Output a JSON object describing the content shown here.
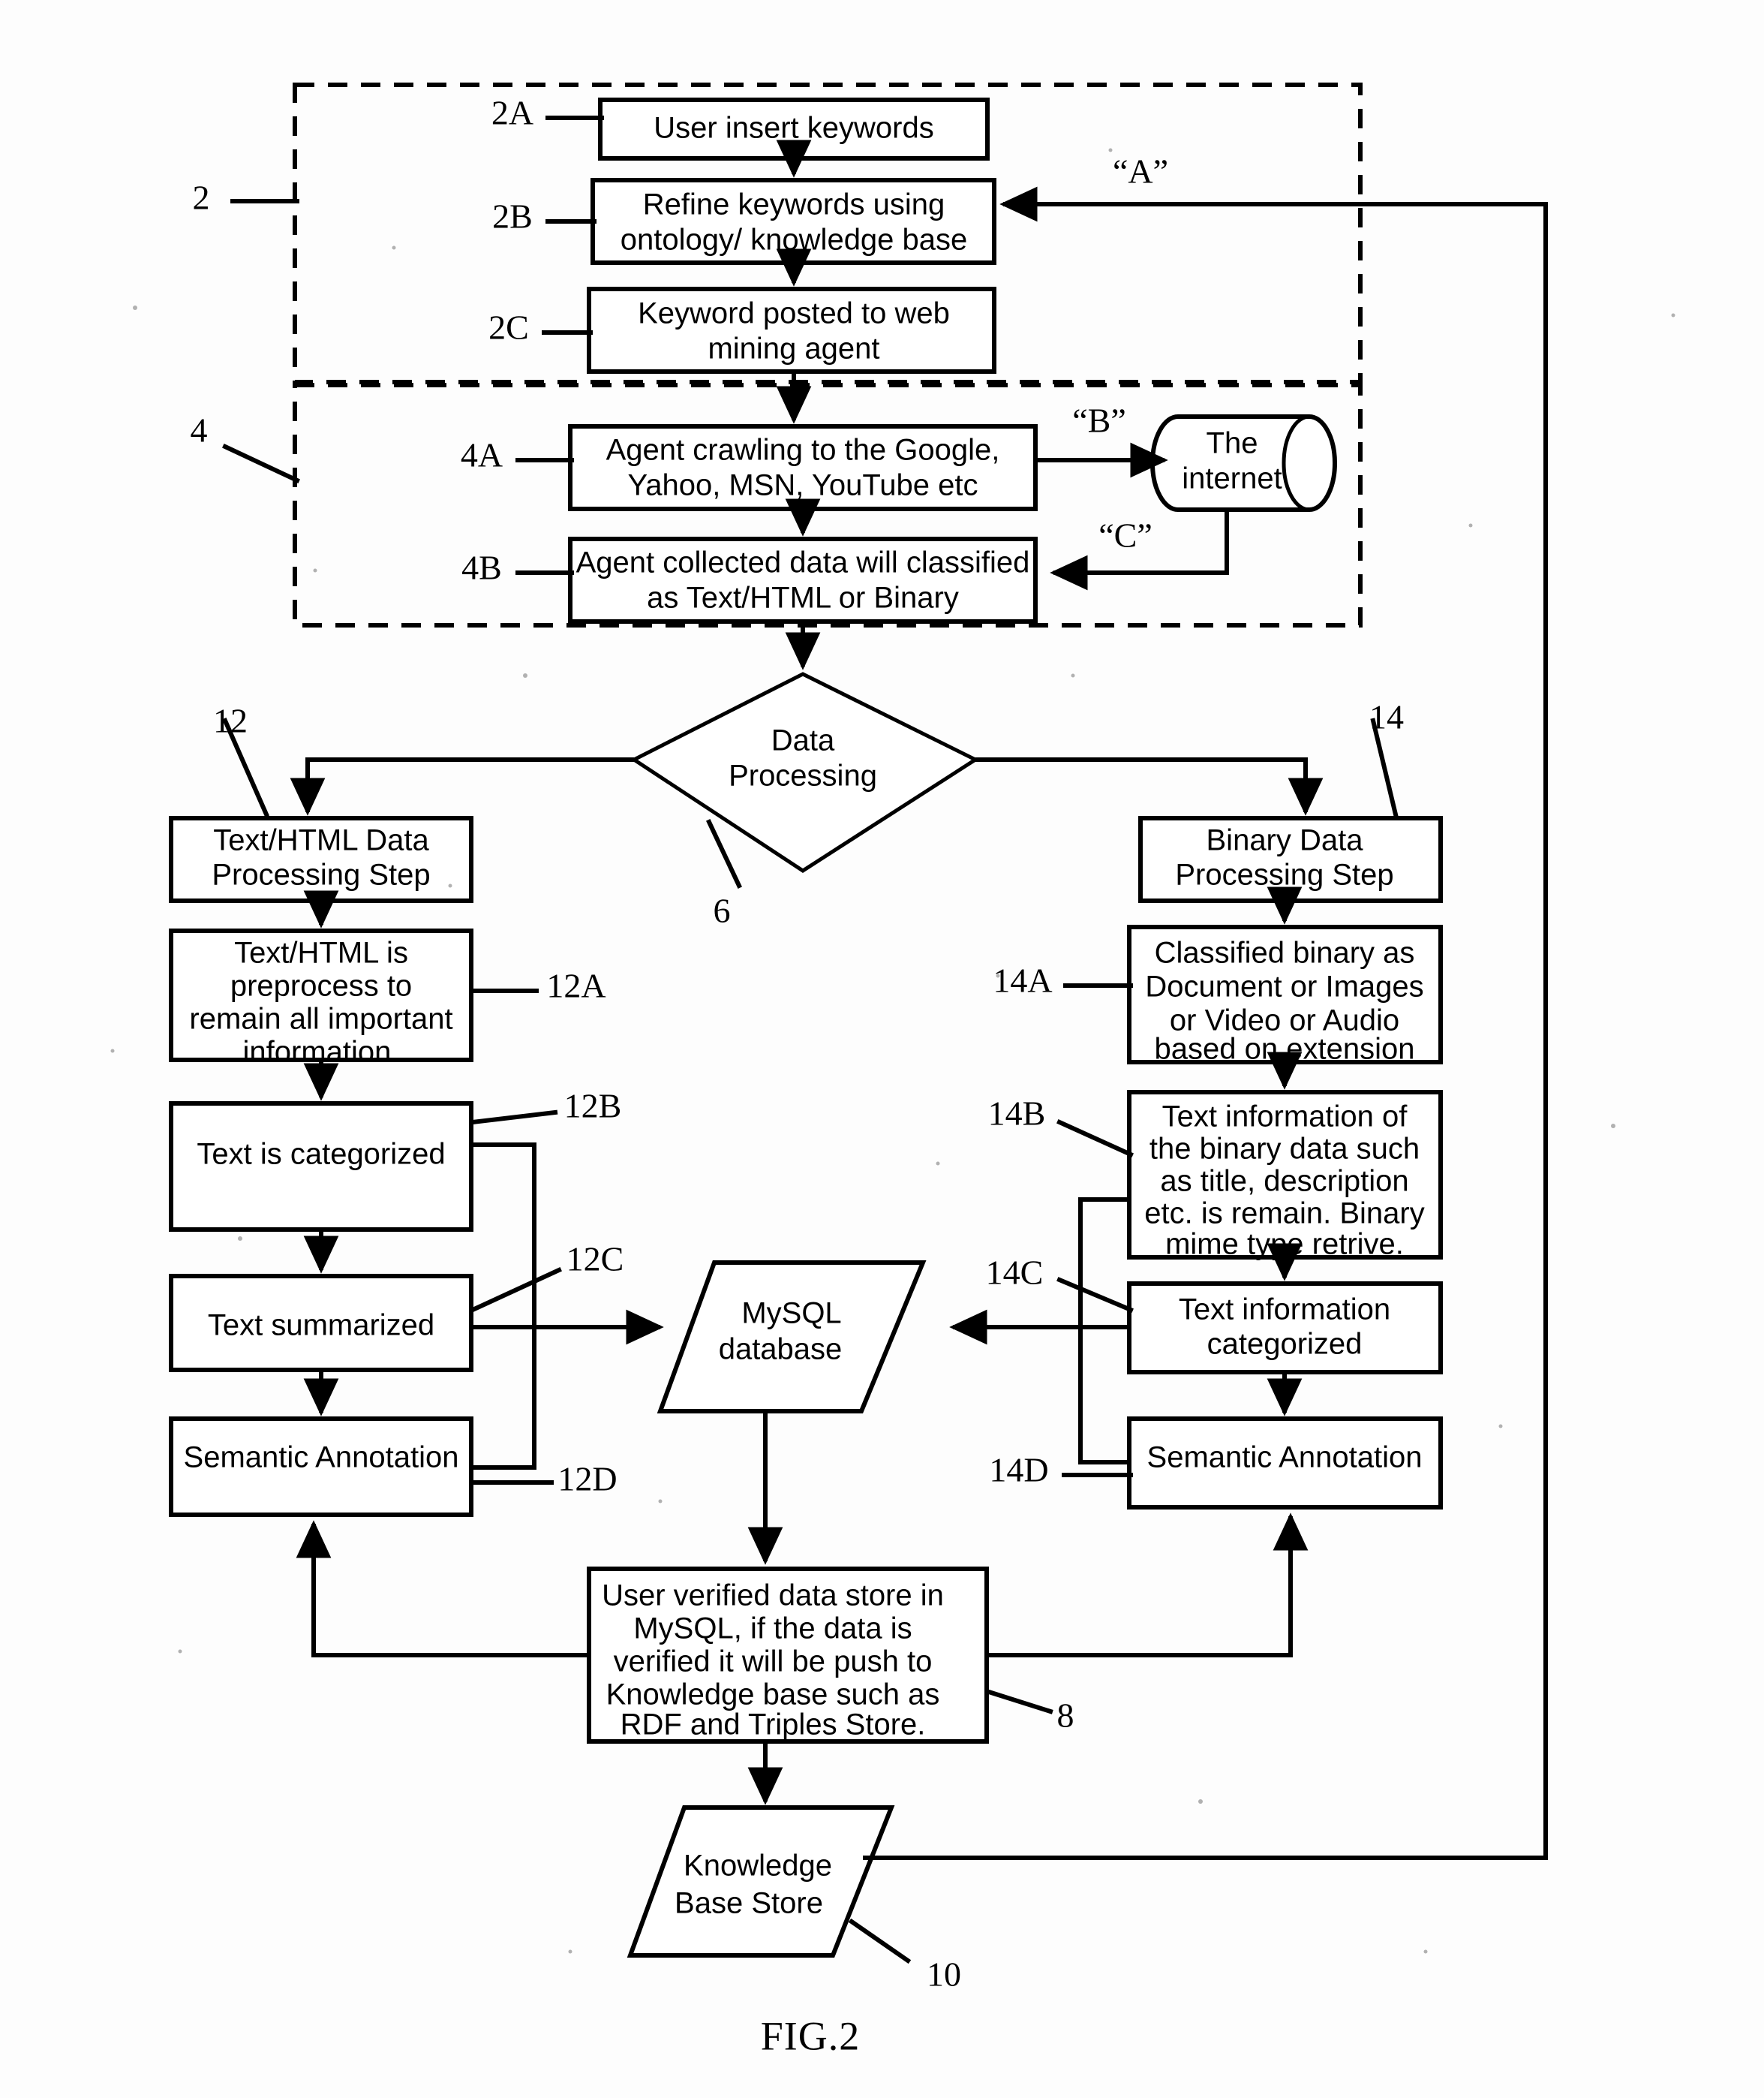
{
  "figure": {
    "label": "FIG.2",
    "title_none": ""
  },
  "groups": [
    {
      "id": "g2",
      "ref": "2"
    },
    {
      "id": "g4",
      "ref": "4"
    }
  ],
  "connectors": [
    {
      "id": "A",
      "label": "“A”"
    },
    {
      "id": "B",
      "label": "“B”"
    },
    {
      "id": "C",
      "label": "“C”"
    }
  ],
  "nodes": {
    "n2A": {
      "ref": "2A",
      "shape": "process",
      "lines": [
        "User insert keywords"
      ]
    },
    "n2B": {
      "ref": "2B",
      "shape": "process",
      "lines": [
        "Refine keywords using",
        "ontology/ knowledge base"
      ]
    },
    "n2C": {
      "ref": "2C",
      "shape": "process",
      "lines": [
        "Keyword posted to web",
        "mining agent"
      ]
    },
    "n4A": {
      "ref": "4A",
      "shape": "process",
      "lines": [
        "Agent crawling to the Google,",
        "Yahoo, MSN, YouTube etc"
      ]
    },
    "n4B": {
      "ref": "4B",
      "shape": "process",
      "lines": [
        "Agent collected data will classified",
        "as Text/HTML or Binary"
      ]
    },
    "nInternet": {
      "ref": "",
      "shape": "cylinder",
      "lines": [
        "The",
        "internet"
      ]
    },
    "n6": {
      "ref": "6",
      "shape": "decision",
      "lines": [
        "Data",
        "Processing"
      ]
    },
    "n12": {
      "ref": "12",
      "shape": "process",
      "lines": [
        "Text/HTML Data",
        "Processing Step"
      ]
    },
    "n12A": {
      "ref": "12A",
      "shape": "process",
      "lines": [
        "Text/HTML is",
        "preprocess to",
        "remain all important",
        "information."
      ]
    },
    "n12B": {
      "ref": "12B",
      "shape": "process",
      "lines": [
        "Text is categorized"
      ]
    },
    "n12C": {
      "ref": "12C",
      "shape": "process",
      "lines": [
        "Text summarized"
      ]
    },
    "n12D": {
      "ref": "12D",
      "shape": "process",
      "lines": [
        "Semantic Annotation"
      ]
    },
    "n14": {
      "ref": "14",
      "shape": "process",
      "lines": [
        "Binary Data",
        "Processing Step"
      ]
    },
    "n14A": {
      "ref": "14A",
      "shape": "process",
      "lines": [
        "Classified binary as",
        "Document or Images",
        "or Video or Audio",
        "based on extension"
      ]
    },
    "n14B": {
      "ref": "14B",
      "shape": "process",
      "lines": [
        "Text information of",
        "the binary data such",
        "as title, description",
        "etc. is remain. Binary",
        "mime type retrive."
      ]
    },
    "n14C": {
      "ref": "14C",
      "shape": "process",
      "lines": [
        "Text information",
        "categorized"
      ]
    },
    "n14D": {
      "ref": "14D",
      "shape": "process",
      "lines": [
        "Semantic Annotation"
      ]
    },
    "nMySQL": {
      "ref": "",
      "shape": "parallelogram",
      "lines": [
        "MySQL",
        "database"
      ]
    },
    "n8": {
      "ref": "8",
      "shape": "process",
      "lines": [
        "User verified data store in",
        "MySQL, if the data is",
        "verified it will be push to",
        "Knowledge base such as",
        "RDF and Triples Store."
      ]
    },
    "n10": {
      "ref": "10",
      "shape": "parallelogram",
      "lines": [
        "Knowledge",
        "Base Store"
      ]
    }
  },
  "chart_data": {
    "type": "diagram",
    "diagram_kind": "flowchart",
    "title": "FIG.2",
    "flow_edges": [
      {
        "from": "n2A",
        "to": "n2B"
      },
      {
        "from": "n2B",
        "to": "n2C"
      },
      {
        "from": "n2C",
        "to": "n4A"
      },
      {
        "from": "n4A",
        "to": "n4B"
      },
      {
        "from": "n4A",
        "to": "nInternet",
        "label": "“B”"
      },
      {
        "from": "nInternet",
        "to": "n4B",
        "label": "“C”"
      },
      {
        "from": "n4B",
        "to": "n6"
      },
      {
        "from": "n6",
        "to": "n12"
      },
      {
        "from": "n6",
        "to": "n14"
      },
      {
        "from": "n12",
        "to": "n12A"
      },
      {
        "from": "n12A",
        "to": "n12B"
      },
      {
        "from": "n12B",
        "to": "n12C"
      },
      {
        "from": "n12C",
        "to": "n12D"
      },
      {
        "from": "n12C",
        "to": "nMySQL"
      },
      {
        "from": "n12B",
        "to": "n12D",
        "kind": "side-bus"
      },
      {
        "from": "n14",
        "to": "n14A"
      },
      {
        "from": "n14A",
        "to": "n14B"
      },
      {
        "from": "n14B",
        "to": "n14C"
      },
      {
        "from": "n14C",
        "to": "n14D"
      },
      {
        "from": "n14C",
        "to": "nMySQL"
      },
      {
        "from": "n14B",
        "to": "n14D",
        "kind": "side-bus"
      },
      {
        "from": "nMySQL",
        "to": "n8"
      },
      {
        "from": "n8",
        "to": "n10"
      },
      {
        "from": "n8",
        "to": "n12D",
        "kind": "feedback"
      },
      {
        "from": "n8",
        "to": "n14D",
        "kind": "feedback"
      },
      {
        "from": "n10",
        "to": "n2B",
        "kind": "feedback",
        "label": "“A”"
      }
    ]
  }
}
